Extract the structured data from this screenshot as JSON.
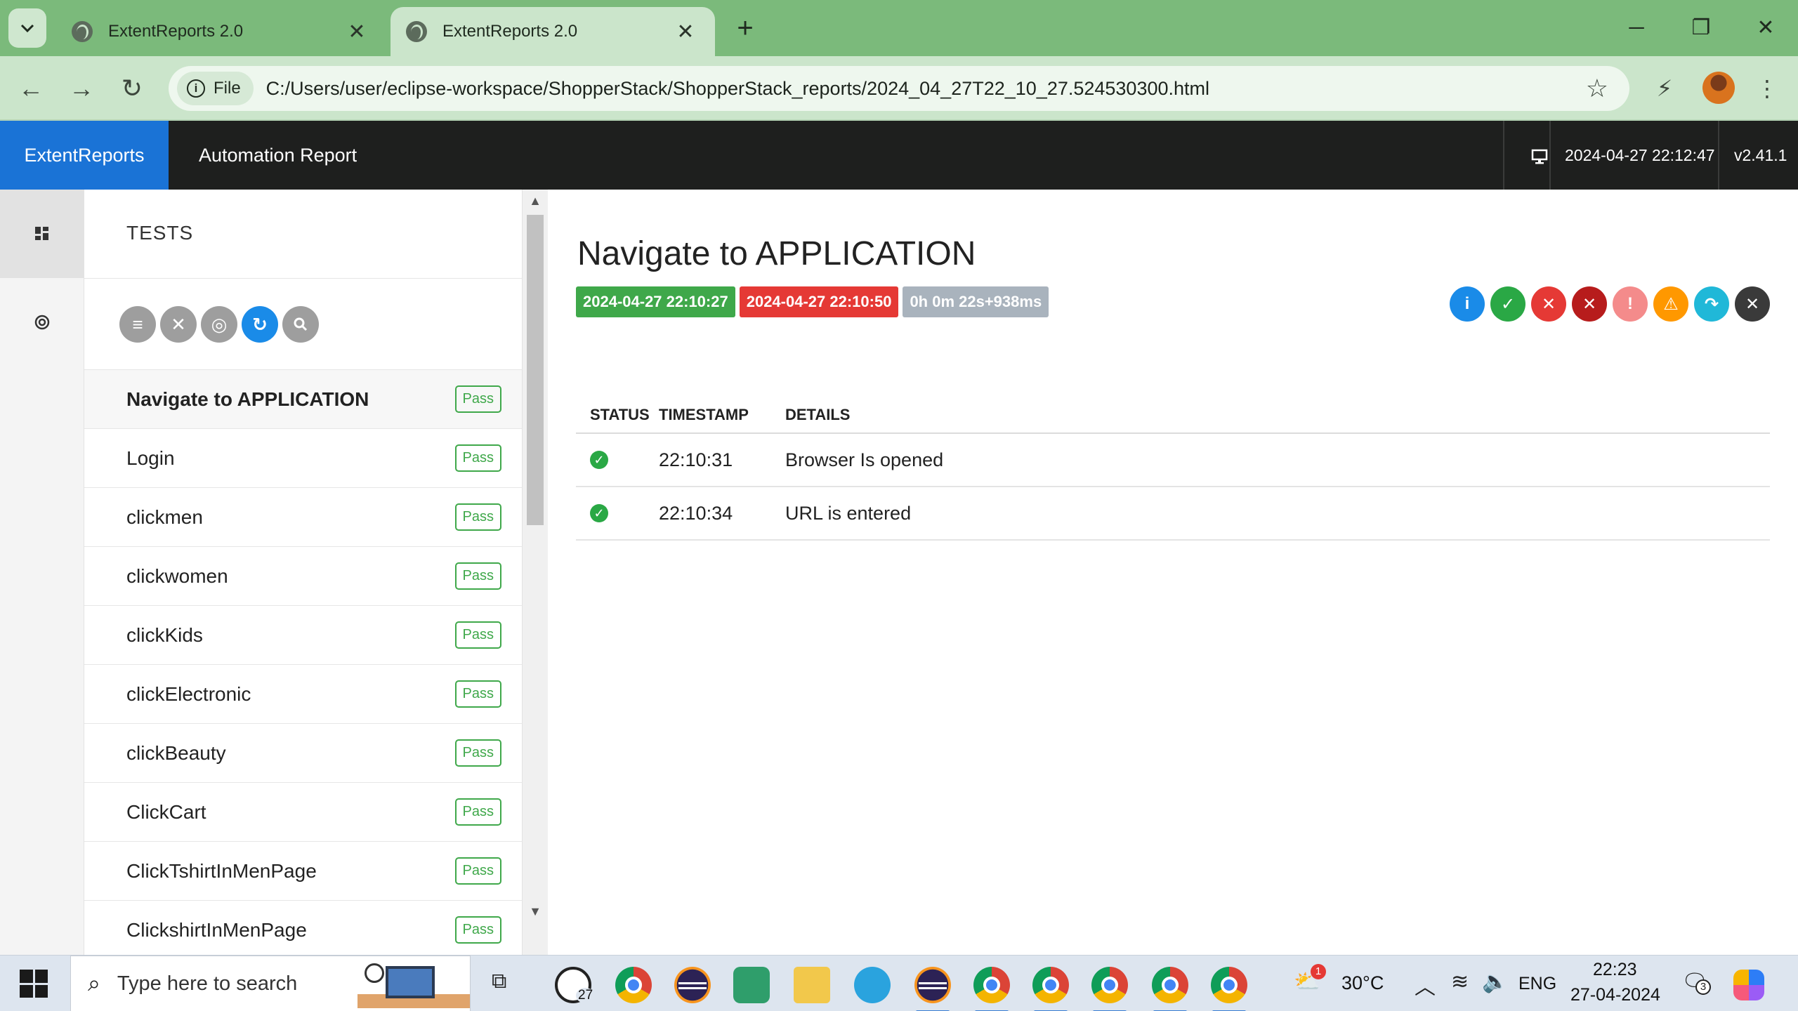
{
  "browser": {
    "tabs": [
      {
        "title": "ExtentReports 2.0",
        "active": false
      },
      {
        "title": "ExtentReports 2.0",
        "active": true
      }
    ],
    "new_tab_label": "+",
    "address": {
      "scheme_label": "File",
      "url": "C:/Users/user/eclipse-workspace/ShopperStack/ShopperStack_reports/2024_04_27T22_10_27.524530300.html"
    }
  },
  "header": {
    "brand": "ExtentReports",
    "report_name": "Automation Report",
    "timestamp": "2024-04-27 22:12:47",
    "version": "v2.41.1"
  },
  "tests_panel": {
    "title": "TESTS",
    "tests": [
      {
        "name": "Navigate to APPLICATION",
        "status": "Pass"
      },
      {
        "name": "Login",
        "status": "Pass"
      },
      {
        "name": "clickmen",
        "status": "Pass"
      },
      {
        "name": "clickwomen",
        "status": "Pass"
      },
      {
        "name": "clickKids",
        "status": "Pass"
      },
      {
        "name": "clickElectronic",
        "status": "Pass"
      },
      {
        "name": "clickBeauty",
        "status": "Pass"
      },
      {
        "name": "ClickCart",
        "status": "Pass"
      },
      {
        "name": "ClickTshirtInMenPage",
        "status": "Pass"
      },
      {
        "name": "ClickshirtInMenPage",
        "status": "Pass"
      }
    ]
  },
  "detail": {
    "title": "Navigate to APPLICATION",
    "start_time": "2024-04-27 22:10:27",
    "end_time": "2024-04-27 22:10:50",
    "duration": "0h 0m 22s+938ms",
    "columns": [
      "STATUS",
      "TIMESTAMP",
      "DETAILS"
    ],
    "logs": [
      {
        "status": "pass",
        "timestamp": "22:10:31",
        "details": "Browser Is opened"
      },
      {
        "status": "pass",
        "timestamp": "22:10:34",
        "details": "URL is entered"
      }
    ]
  },
  "colors": {
    "brand_blue": "#1a73d6",
    "pass_green": "#3fa84a",
    "fail_red": "#e53935",
    "skip_gray": "#a9b3bd"
  },
  "taskbar": {
    "search_placeholder": "Type here to search",
    "whatsapp_count": "27",
    "weather_badge": "1",
    "temperature": "30°C",
    "language": "ENG",
    "time": "22:23",
    "date": "27-04-2024",
    "notifications": "3"
  }
}
